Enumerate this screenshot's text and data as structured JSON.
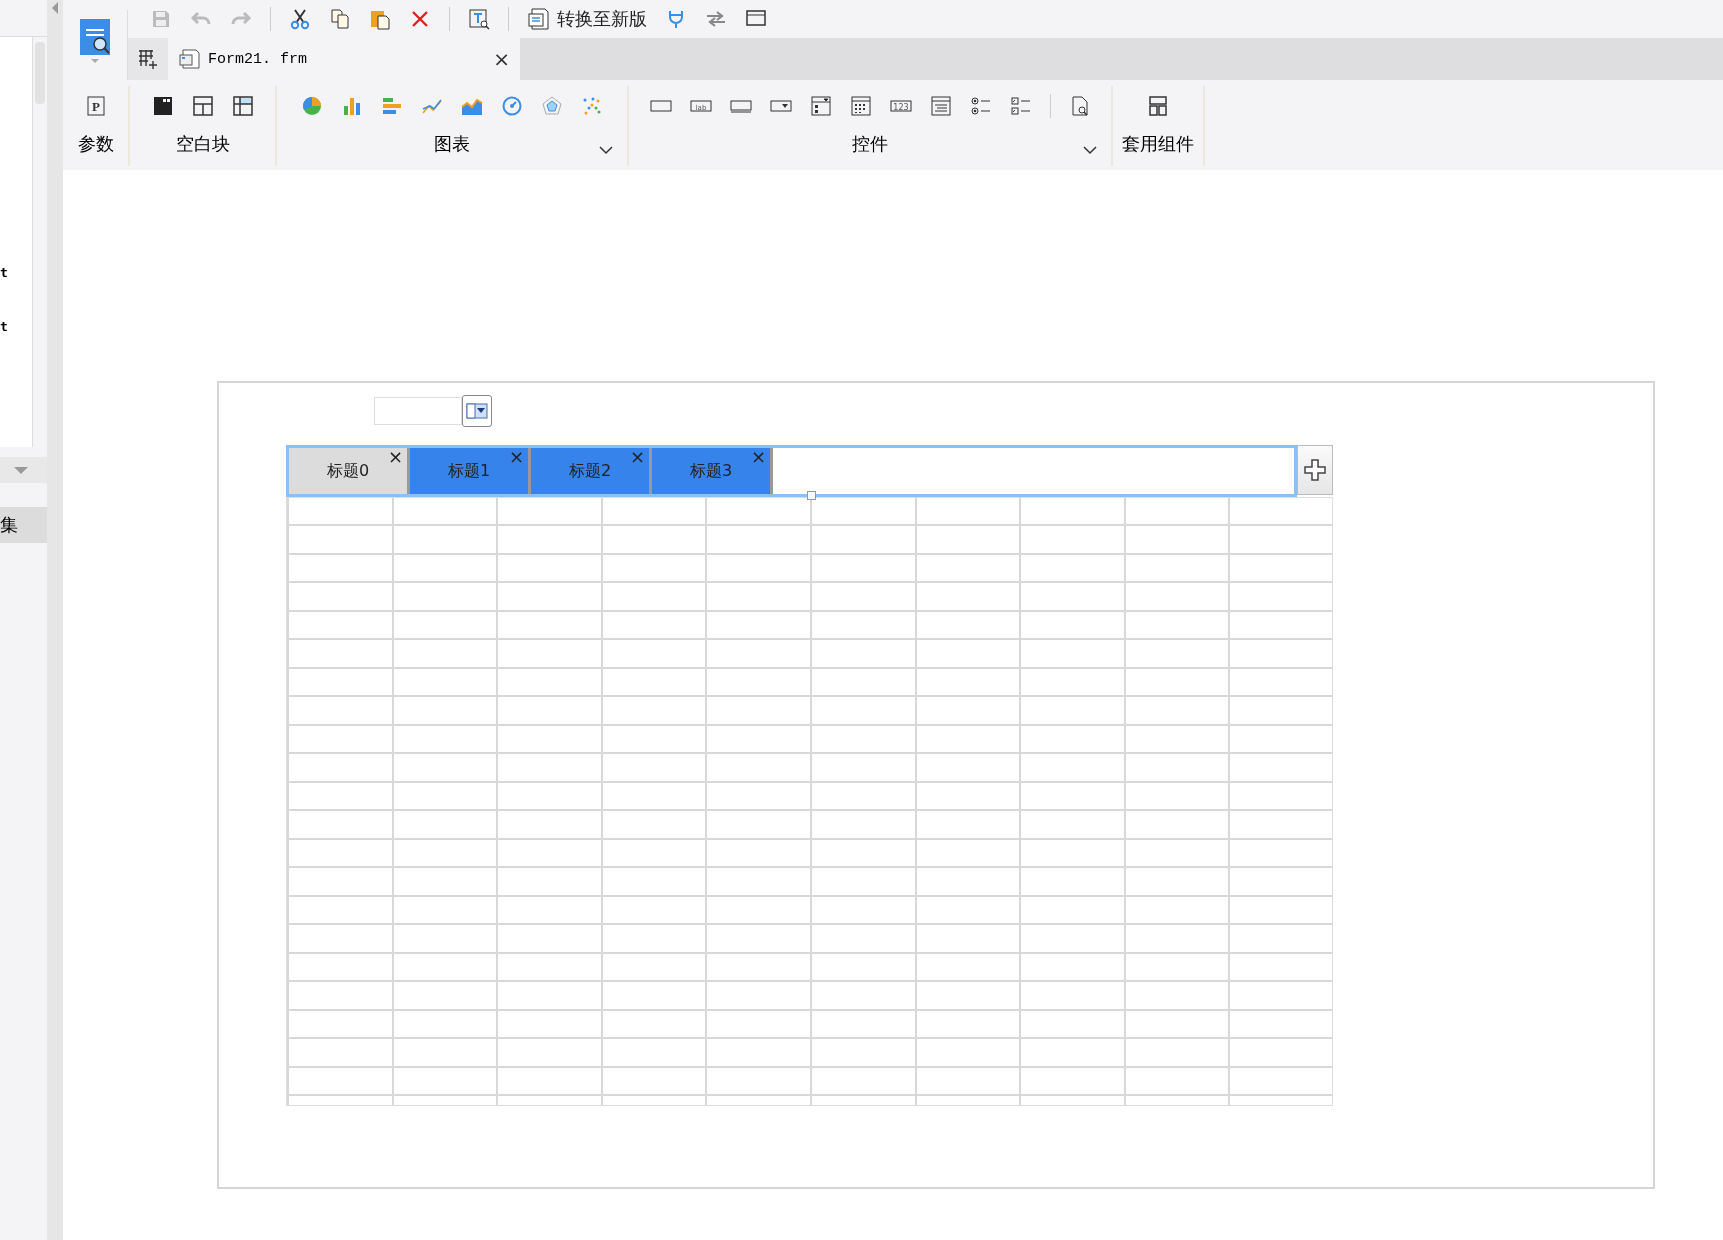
{
  "side_panel": {
    "items": [
      {
        "label": "t"
      },
      {
        "label": "t"
      }
    ],
    "section": {
      "label": "集",
      "selected": true
    }
  },
  "toolbar": {
    "convert_button": {
      "label": "转换至新版"
    }
  },
  "file_tab": {
    "label": "Form21. frm",
    "close": "×"
  },
  "ribbon": {
    "icon_texts": {
      "parameter": "P",
      "label": "lab",
      "number": "123"
    },
    "groups": [
      {
        "label": "参数",
        "menu": false
      },
      {
        "label": "空白块",
        "menu": false
      },
      {
        "label": "图表",
        "menu": true
      },
      {
        "label": "控件",
        "menu": true
      },
      {
        "label": "套用组件",
        "menu": false
      }
    ]
  },
  "canvas": {
    "tabs": [
      {
        "label": "标题0",
        "close": "×",
        "selected": true
      },
      {
        "label": "标题1",
        "close": "×",
        "selected": false
      },
      {
        "label": "标题2",
        "close": "×",
        "selected": false
      },
      {
        "label": "标题3",
        "close": "×",
        "selected": false
      }
    ]
  }
}
